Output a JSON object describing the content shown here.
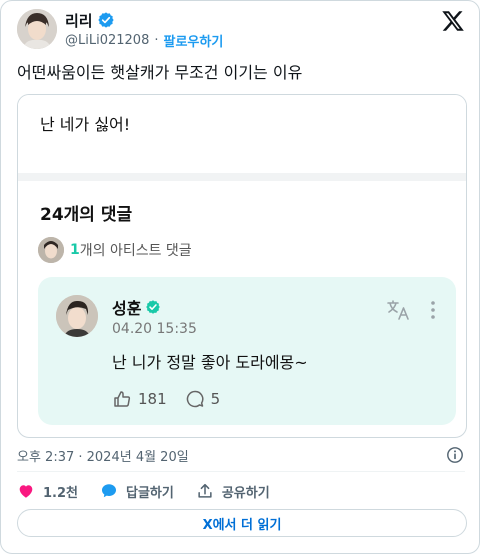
{
  "author": {
    "display_name": "리리",
    "handle": "@LiLi021208",
    "separator": "·",
    "follow_label": "팔로우하기"
  },
  "tweet": {
    "text": "어떤싸움이든 햇살캐가 무조건 이기는 이유"
  },
  "media": {
    "quote_text": "난 네가 싫어!",
    "comments_title": "24개의 댓글",
    "artist_count": "1",
    "artist_label": "개의 아티스트 댓글",
    "comment": {
      "name": "성훈",
      "date": "04.20 15:35",
      "text": "난 니가 정말 좋아 도라에몽~",
      "likes": "181",
      "replies": "5"
    },
    "accent_color": "#19c9a8",
    "card_color": "#e6f8f5"
  },
  "footer": {
    "timestamp": "오후 2:37 · 2024년 4월 20일",
    "likes_count": "1.2천",
    "reply_label": "답글하기",
    "share_label": "공유하기",
    "read_more_label": "X에서 더 읽기"
  },
  "colors": {
    "link": "#1d9bf0",
    "like": "#f91880",
    "verified": "#1d9bf0"
  },
  "icons": [
    "verified-badge-icon",
    "x-logo-icon",
    "translate-icon",
    "more-vertical-icon",
    "heart-icon",
    "comment-bubble-icon",
    "share-icon",
    "info-icon"
  ]
}
